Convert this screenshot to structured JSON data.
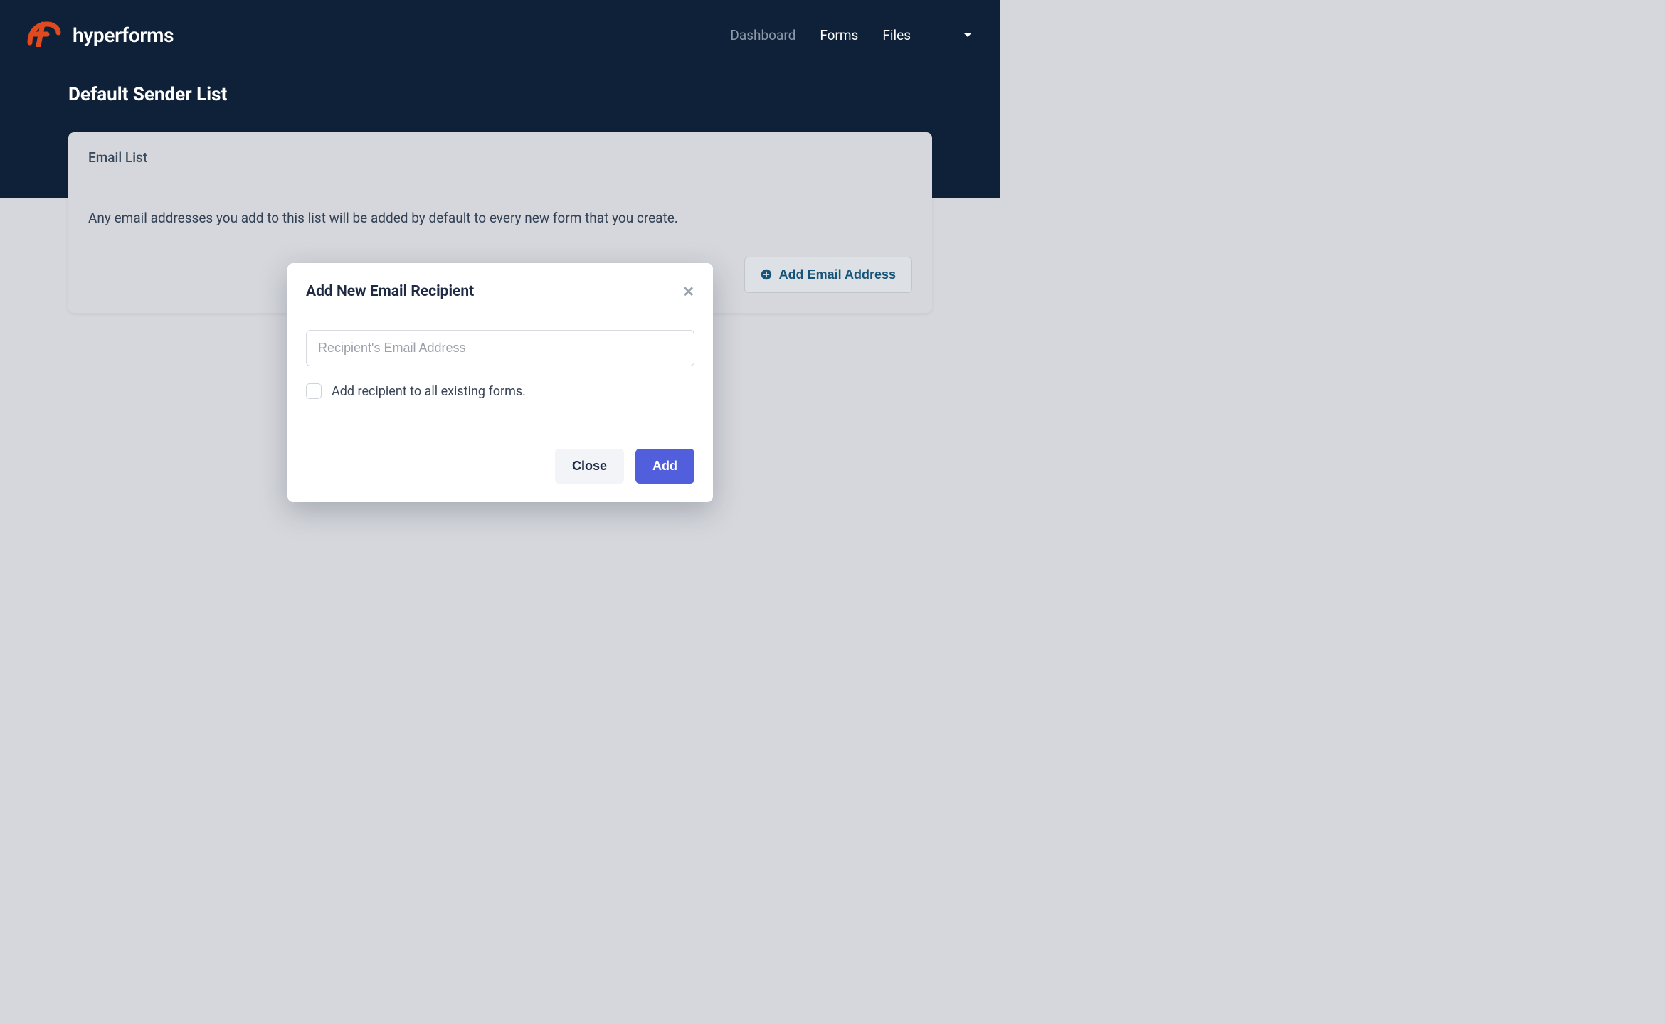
{
  "brand": {
    "name": "hyperforms"
  },
  "nav": {
    "items": [
      {
        "label": "Dashboard",
        "active": false
      },
      {
        "label": "Forms",
        "active": true
      },
      {
        "label": "Files",
        "active": true
      }
    ]
  },
  "page": {
    "title": "Default Sender List"
  },
  "card": {
    "header": "Email List",
    "description": "Any email addresses you add to this list will be added by default to every new form that you create.",
    "add_button": "Add Email Address"
  },
  "modal": {
    "title": "Add New Email Recipient",
    "input_placeholder": "Recipient's Email Address",
    "input_value": "",
    "checkbox_label": "Add recipient to all existing forms.",
    "checkbox_checked": false,
    "close_label": "Close",
    "add_label": "Add"
  },
  "colors": {
    "brand_orange": "#e14a1f",
    "navy": "#0f2138",
    "primary": "#525fdd",
    "link_blue": "#15557a"
  }
}
